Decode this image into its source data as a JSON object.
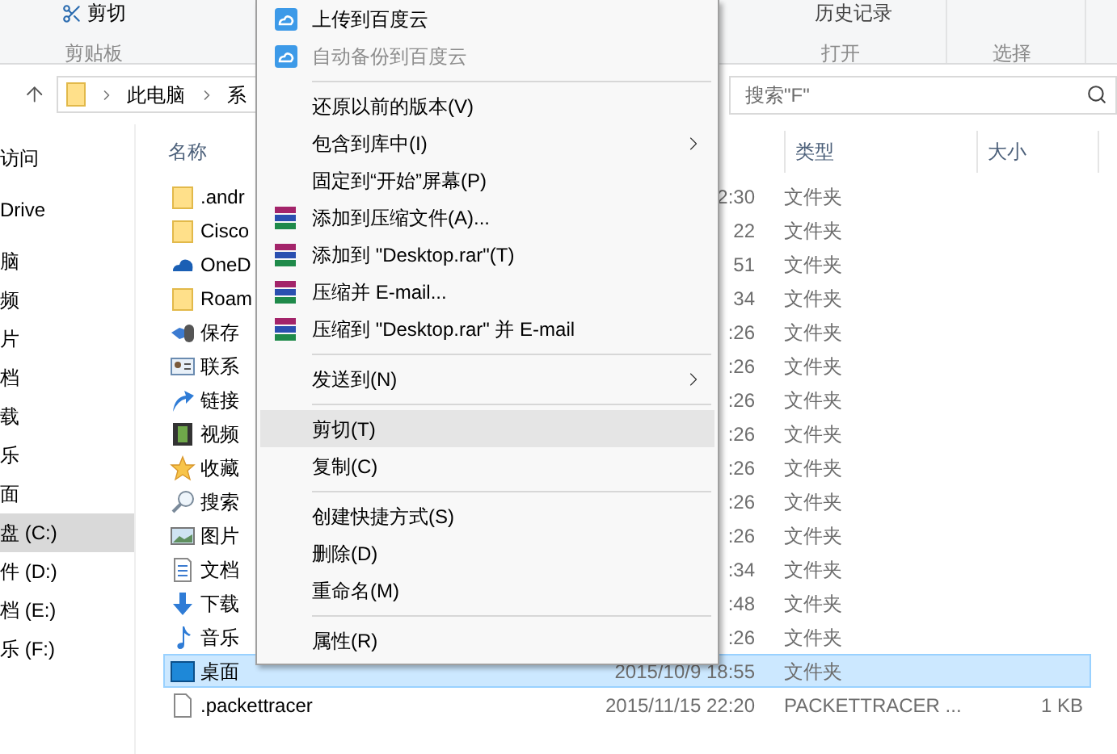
{
  "ribbon": {
    "cut_button": "剪切",
    "clipboard_label": "剪贴板",
    "history_button": "历史记录",
    "open_label": "打开",
    "select_label": "选择"
  },
  "address_bar": {
    "path": [
      "此电脑",
      "系"
    ]
  },
  "search": {
    "placeholder": "搜索\"F\""
  },
  "navigation_pane": {
    "sections": [
      {
        "items": [
          {
            "label": "访问",
            "selected": false
          }
        ]
      },
      {
        "items": [
          {
            "label": "Drive",
            "selected": false
          }
        ]
      },
      {
        "items": [
          {
            "label": "脑",
            "selected": false
          },
          {
            "label": "频",
            "selected": false
          },
          {
            "label": "片",
            "selected": false
          },
          {
            "label": "档",
            "selected": false
          },
          {
            "label": "载",
            "selected": false
          },
          {
            "label": "乐",
            "selected": false
          },
          {
            "label": "面",
            "selected": false
          },
          {
            "label": "盘 (C:)",
            "selected": true
          },
          {
            "label": "件 (D:)",
            "selected": false
          },
          {
            "label": "档 (E:)",
            "selected": false
          },
          {
            "label": "乐 (F:)",
            "selected": false
          }
        ]
      }
    ]
  },
  "file_list": {
    "columns": [
      "名称",
      "类型",
      "大小"
    ],
    "rows": [
      {
        "kind": "folder",
        "name": ".andr",
        "date": "2:30",
        "type": "文件夹",
        "selected": false
      },
      {
        "kind": "folder",
        "name": "Cisco",
        "date": "22",
        "type": "文件夹",
        "selected": false
      },
      {
        "kind": "cloud",
        "name": "OneD",
        "date": "51",
        "type": "文件夹",
        "selected": false
      },
      {
        "kind": "folder",
        "name": "Roam",
        "date": "34",
        "type": "文件夹",
        "selected": false
      },
      {
        "kind": "games",
        "name": "保存",
        "date": ":26",
        "type": "文件夹",
        "selected": false
      },
      {
        "kind": "contact",
        "name": "联系",
        "date": ":26",
        "type": "文件夹",
        "selected": false
      },
      {
        "kind": "link",
        "name": "链接",
        "date": ":26",
        "type": "文件夹",
        "selected": false
      },
      {
        "kind": "video",
        "name": "视频",
        "date": ":26",
        "type": "文件夹",
        "selected": false
      },
      {
        "kind": "star",
        "name": "收藏",
        "date": ":26",
        "type": "文件夹",
        "selected": false
      },
      {
        "kind": "search",
        "name": "搜索",
        "date": ":26",
        "type": "文件夹",
        "selected": false
      },
      {
        "kind": "picture",
        "name": "图片",
        "date": ":26",
        "type": "文件夹",
        "selected": false
      },
      {
        "kind": "document",
        "name": "文档",
        "date": ":34",
        "type": "文件夹",
        "selected": false
      },
      {
        "kind": "download",
        "name": "下载",
        "date": ":48",
        "type": "文件夹",
        "selected": false
      },
      {
        "kind": "music",
        "name": "音乐",
        "date": ":26",
        "type": "文件夹",
        "selected": false
      },
      {
        "kind": "desktop",
        "name": "桌面",
        "date": "2015/10/9 18:55",
        "type": "文件夹",
        "selected": true
      },
      {
        "kind": "file",
        "name": ".packettracer",
        "date": "2015/11/15 22:20",
        "type": "PACKETTRACER ...",
        "size": "1 KB",
        "selected": false
      }
    ]
  },
  "context_menu": {
    "items": [
      {
        "kind": "cloud",
        "label": "上传到百度云",
        "disabled": false,
        "submenu": false,
        "selected": false
      },
      {
        "kind": "cloud",
        "label": "自动备份到百度云",
        "disabled": true,
        "submenu": false,
        "selected": false
      },
      {
        "kind": "separator"
      },
      {
        "kind": "plain",
        "label": "还原以前的版本(V)",
        "disabled": false,
        "submenu": false,
        "selected": false
      },
      {
        "kind": "plain",
        "label": "包含到库中(I)",
        "disabled": false,
        "submenu": true,
        "selected": false
      },
      {
        "kind": "plain",
        "label": "固定到“开始”屏幕(P)",
        "disabled": false,
        "submenu": false,
        "selected": false
      },
      {
        "kind": "archive",
        "label": "添加到压缩文件(A)...",
        "disabled": false,
        "submenu": false,
        "selected": false
      },
      {
        "kind": "archive",
        "label": "添加到 \"Desktop.rar\"(T)",
        "disabled": false,
        "submenu": false,
        "selected": false
      },
      {
        "kind": "archive",
        "label": "压缩并 E-mail...",
        "disabled": false,
        "submenu": false,
        "selected": false
      },
      {
        "kind": "archive",
        "label": "压缩到 \"Desktop.rar\" 并 E-mail",
        "disabled": false,
        "submenu": false,
        "selected": false
      },
      {
        "kind": "separator"
      },
      {
        "kind": "plain",
        "label": "发送到(N)",
        "disabled": false,
        "submenu": true,
        "selected": false
      },
      {
        "kind": "separator"
      },
      {
        "kind": "plain",
        "label": "剪切(T)",
        "disabled": false,
        "submenu": false,
        "selected": true
      },
      {
        "kind": "plain",
        "label": "复制(C)",
        "disabled": false,
        "submenu": false,
        "selected": false
      },
      {
        "kind": "separator"
      },
      {
        "kind": "plain",
        "label": "创建快捷方式(S)",
        "disabled": false,
        "submenu": false,
        "selected": false
      },
      {
        "kind": "plain",
        "label": "删除(D)",
        "disabled": false,
        "submenu": false,
        "selected": false
      },
      {
        "kind": "plain",
        "label": "重命名(M)",
        "disabled": false,
        "submenu": false,
        "selected": false
      },
      {
        "kind": "separator"
      },
      {
        "kind": "plain",
        "label": "属性(R)",
        "disabled": false,
        "submenu": false,
        "selected": false
      }
    ]
  }
}
